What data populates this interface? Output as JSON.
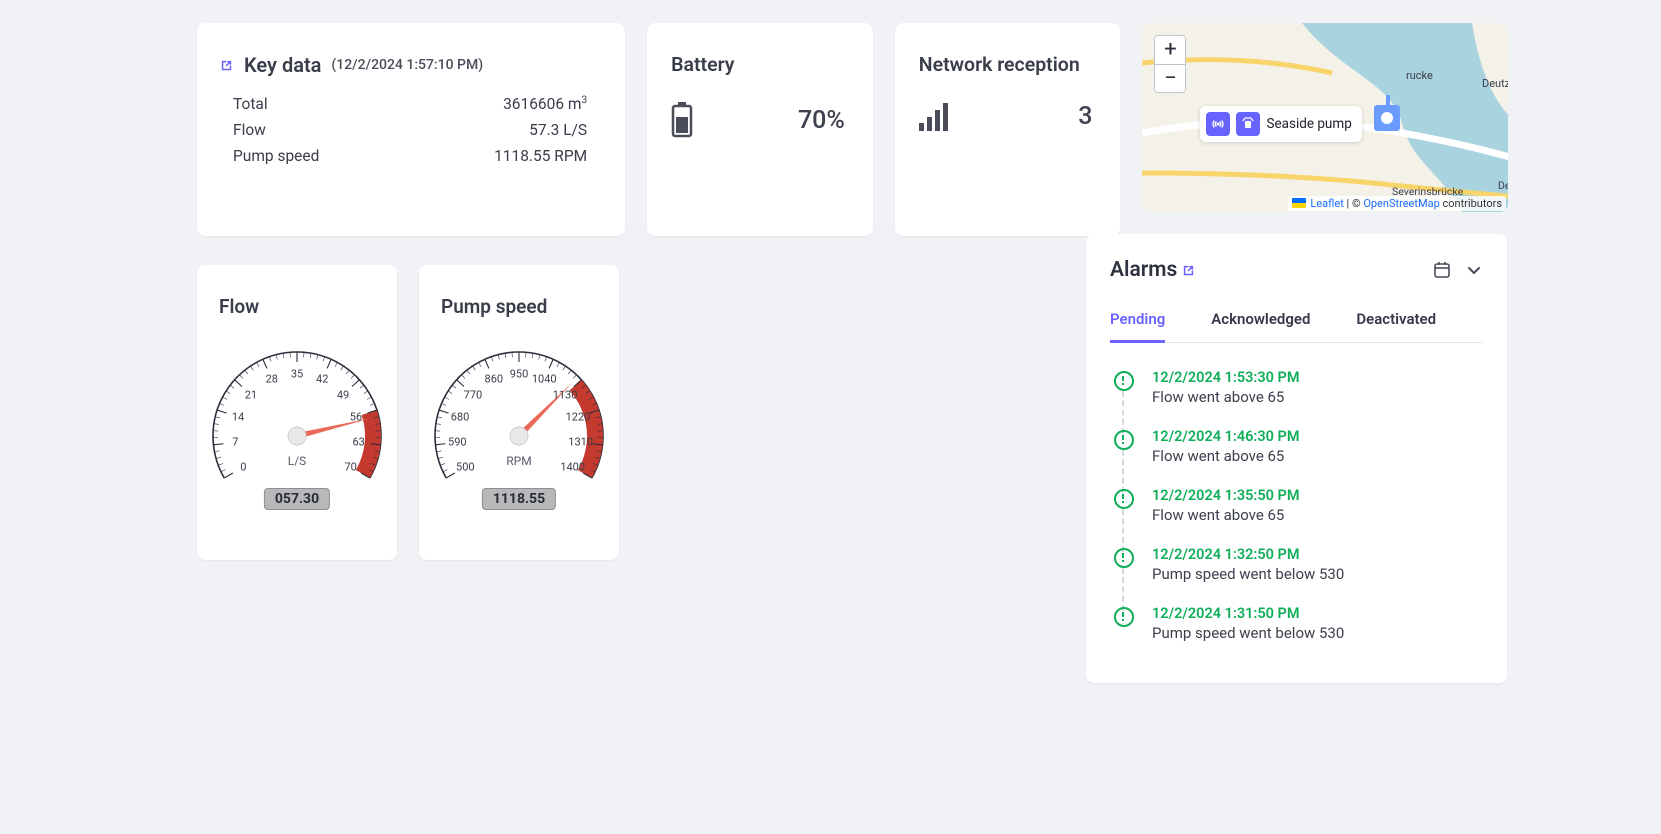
{
  "key_data": {
    "title": "Key data",
    "timestamp": "(12/2/2024 1:57:10 PM)",
    "rows": [
      {
        "label": "Total",
        "value": "3616606 m",
        "suffix": "3"
      },
      {
        "label": "Flow",
        "value": "57.3 L/S",
        "suffix": ""
      },
      {
        "label": "Pump speed",
        "value": "1118.55 RPM",
        "suffix": ""
      }
    ]
  },
  "battery": {
    "title": "Battery",
    "value": "70%"
  },
  "network": {
    "title": "Network reception",
    "value": "3"
  },
  "map": {
    "marker_label": "Seaside pump",
    "attr_leaflet": "Leaflet",
    "attr_sep": " | © ",
    "attr_osm": "OpenStreetMap",
    "attr_tail": " contributors",
    "place_labels": [
      "Deutzer",
      "Deutz",
      "rucke",
      "Severinsbrücke",
      "Deutzer Ring"
    ]
  },
  "gauges": {
    "flow": {
      "title": "Flow",
      "unit": "L/S",
      "reading": "057.30",
      "min": 0,
      "max": 70,
      "value": 57.3,
      "red_from": 56,
      "ticks": [
        "0",
        "7",
        "14",
        "21",
        "28",
        "35",
        "42",
        "49",
        "56",
        "63",
        "70"
      ]
    },
    "pump": {
      "title": "Pump speed",
      "unit": "RPM",
      "reading": "1118.55",
      "min": 500,
      "max": 1400,
      "value": 1118.55,
      "red_from": 1130,
      "ticks": [
        "500",
        "590",
        "680",
        "770",
        "860",
        "950",
        "1040",
        "1130",
        "1220",
        "1310",
        "1400"
      ]
    }
  },
  "alarms": {
    "title": "Alarms",
    "tabs": [
      "Pending",
      "Acknowledged",
      "Deactivated"
    ],
    "active_tab": 0,
    "items": [
      {
        "time": "12/2/2024 1:53:30 PM",
        "msg": "Flow went above 65"
      },
      {
        "time": "12/2/2024 1:46:30 PM",
        "msg": "Flow went above 65"
      },
      {
        "time": "12/2/2024 1:35:50 PM",
        "msg": "Flow went above 65"
      },
      {
        "time": "12/2/2024 1:32:50 PM",
        "msg": "Pump speed went below 530"
      },
      {
        "time": "12/2/2024 1:31:50 PM",
        "msg": "Pump speed went below 530"
      }
    ]
  },
  "icon_names": {
    "external": "external-link-icon",
    "battery": "battery-icon",
    "signal": "signal-icon",
    "calendar": "calendar-icon",
    "chevron": "chevron-down-icon"
  },
  "colors": {
    "accent": "#6b63ff",
    "green": "#0fae58",
    "danger": "#c43a2f"
  }
}
